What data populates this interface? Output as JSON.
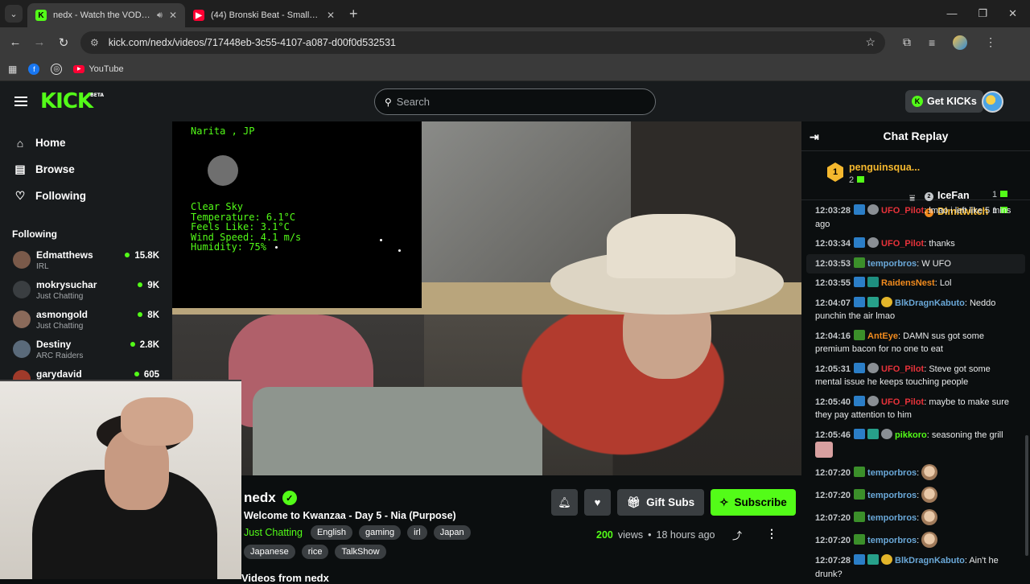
{
  "browser": {
    "tabs": [
      {
        "title": "nedx - Watch the VOD on Kick",
        "active": true
      },
      {
        "title": "(44) Bronski Beat - Smalltown Boy",
        "active": false
      }
    ],
    "url": "kick.com/nedx/videos/717448eb-3c55-4107-a087-d00f0d532531",
    "bookmarks": [
      {
        "label": ""
      },
      {
        "label": ""
      },
      {
        "label": "YouTube"
      }
    ]
  },
  "header": {
    "logo": "KICK",
    "logo_badge": "BETA",
    "search_placeholder": "Search",
    "get_kicks": "Get KICKs"
  },
  "sidebar": {
    "nav": [
      {
        "label": "Home",
        "icon": "home-icon"
      },
      {
        "label": "Browse",
        "icon": "browse-icon"
      },
      {
        "label": "Following",
        "icon": "heart-icon"
      }
    ],
    "following_heading": "Following",
    "following": [
      {
        "name": "Edmatthews",
        "category": "IRL",
        "viewers": "15.8K",
        "color": "#7a5a4a"
      },
      {
        "name": "mokrysuchar",
        "category": "Just Chatting",
        "viewers": "9K",
        "color": "#3a3e41"
      },
      {
        "name": "asmongold",
        "category": "Just Chatting",
        "viewers": "8K",
        "color": "#8a6a5a"
      },
      {
        "name": "Destiny",
        "category": "ARC Raiders",
        "viewers": "2.8K",
        "color": "#5a6a7a"
      },
      {
        "name": "garydavid",
        "category": "",
        "viewers": "605",
        "color": "#a03a2a"
      }
    ]
  },
  "video_overlay": {
    "location": "Narita , JP",
    "weather": [
      "Clear Sky",
      "Temperature: 6.1°C",
      "Feels Like: 3.1°C",
      "Wind Speed: 4.1 m/s",
      "Humidity: 75%"
    ]
  },
  "stream": {
    "streamer": "nedx",
    "title": "Welcome to Kwanzaa - Day 5 - Nia (Purpose)",
    "category": "Just Chatting",
    "tags": [
      "English",
      "gaming",
      "irl",
      "Japan",
      "Japanese",
      "rice",
      "TalkShow"
    ],
    "gift_subs": "Gift Subs",
    "subscribe": "Subscribe",
    "views_count": "200",
    "views_label": "views",
    "age": "18 hours ago",
    "more_from": "Videos from nedx"
  },
  "chat": {
    "title": "Chat Replay",
    "leaderboard": {
      "first": {
        "rank": "1",
        "name": "penguinsqua...",
        "count": "2"
      },
      "second": {
        "rank": "2",
        "name": "IceFan",
        "count": "1"
      },
      "third": {
        "rank": "3",
        "name": "Dimitwitch",
        "count": "1"
      }
    },
    "messages": [
      {
        "time": "12:03:28",
        "user": "UFO_Pilot",
        "color": "#e8323a",
        "text": "lmao i left like 5 mins ago",
        "badges": [
          "b-blue",
          "b-gray"
        ]
      },
      {
        "time": "12:03:34",
        "user": "UFO_Pilot",
        "color": "#e8323a",
        "text": "thanks",
        "badges": [
          "b-blue",
          "b-gray"
        ]
      },
      {
        "time": "12:03:53",
        "user": "temporbros",
        "color": "#6aa8d8",
        "text": "W UFO",
        "badges": [
          "b-green"
        ],
        "highlight": true
      },
      {
        "time": "12:03:55",
        "user": "RaidensNest",
        "color": "#f28b1e",
        "text": "Lol",
        "badges": [
          "b-blue",
          "b-teal"
        ]
      },
      {
        "time": "12:04:07",
        "user": "BlkDragnKabuto",
        "color": "#6aa8d8",
        "text": "Neddo punchin the air lmao",
        "badges": [
          "b-blue",
          "b-teal2",
          "b-yellow"
        ]
      },
      {
        "time": "12:04:16",
        "user": "AntEye",
        "color": "#f28b1e",
        "text": "DAMN sus got some premium bacon for no one to eat",
        "badges": [
          "b-green"
        ]
      },
      {
        "time": "12:05:31",
        "user": "UFO_Pilot",
        "color": "#e8323a",
        "text": "Steve got some mental issue he keeps touching people",
        "badges": [
          "b-blue",
          "b-gray"
        ]
      },
      {
        "time": "12:05:40",
        "user": "UFO_Pilot",
        "color": "#e8323a",
        "text": "maybe to make sure they pay attention to him",
        "badges": [
          "b-blue",
          "b-gray"
        ]
      },
      {
        "time": "12:05:46",
        "user": "pikkoro",
        "color": "#53fc18",
        "text": "seasoning the grill",
        "badges": [
          "b-blue",
          "b-teal2",
          "b-gray"
        ],
        "emote_sq": true
      },
      {
        "time": "12:07:20",
        "user": "temporbros",
        "color": "#6aa8d8",
        "text": "",
        "badges": [
          "b-green"
        ],
        "emote": true
      },
      {
        "time": "12:07:20",
        "user": "temporbros",
        "color": "#6aa8d8",
        "text": "",
        "badges": [
          "b-green"
        ],
        "emote": true
      },
      {
        "time": "12:07:20",
        "user": "temporbros",
        "color": "#6aa8d8",
        "text": "",
        "badges": [
          "b-green"
        ],
        "emote": true
      },
      {
        "time": "12:07:20",
        "user": "temporbros",
        "color": "#6aa8d8",
        "text": "",
        "badges": [
          "b-green"
        ],
        "emote": true
      },
      {
        "time": "12:07:28",
        "user": "BlkDragnKabuto",
        "color": "#6aa8d8",
        "text": "Ain't he drunk?",
        "badges": [
          "b-blue",
          "b-teal2",
          "b-yellow"
        ]
      }
    ]
  },
  "colors": {
    "accent": "#53fc18",
    "background": "#0b0e0f",
    "panel": "#181b1d"
  }
}
